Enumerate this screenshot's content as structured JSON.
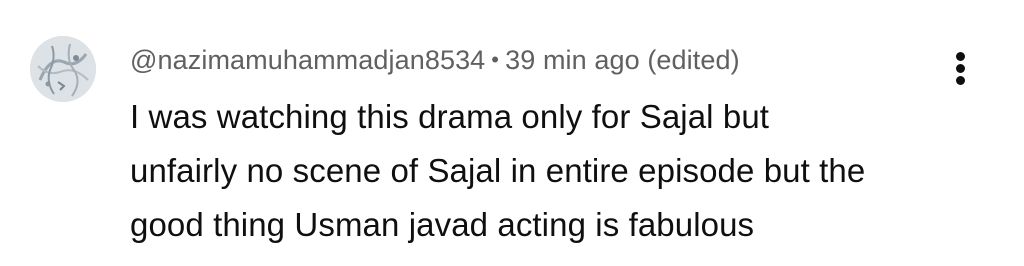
{
  "comment": {
    "author": "@nazimamuhammadjan8534",
    "separator": "•",
    "timestamp": "39 min ago",
    "edited_label": "(edited)",
    "text_lines": [
      "I was watching this drama only for Sajal but",
      "unfairly no scene of Sajal in entire episode but the",
      "good thing Usman javad acting is fabulous"
    ]
  },
  "icons": {
    "menu": "more-vert-icon",
    "avatar": "user-avatar"
  },
  "colors": {
    "author_meta": "#606060",
    "body_text": "#0f0f0f",
    "background": "#ffffff"
  }
}
